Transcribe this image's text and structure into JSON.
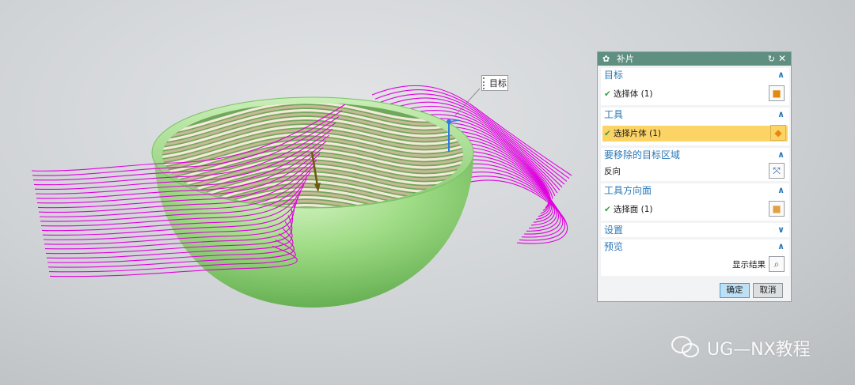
{
  "viewport": {
    "label_target": "目标",
    "colors": {
      "bowl": "#8fd47b",
      "curves": "#e000e0",
      "strips": "#d8c7a8"
    }
  },
  "dialog": {
    "title": "补片",
    "sections": {
      "target": {
        "header": "目标",
        "row_label": "选择体 (1)"
      },
      "tool": {
        "header": "工具",
        "row_label": "选择片体 (1)"
      },
      "remove_region": {
        "header": "要移除的目标区域",
        "row_label": "反向"
      },
      "tool_direction": {
        "header": "工具方向面",
        "row_label": "选择面 (1)"
      },
      "settings": {
        "header": "设置"
      },
      "preview": {
        "header": "预览",
        "row_label": "显示结果"
      }
    },
    "buttons": {
      "ok": "确定",
      "cancel": "取消"
    }
  },
  "watermark": {
    "text": "UG—NX教程"
  }
}
